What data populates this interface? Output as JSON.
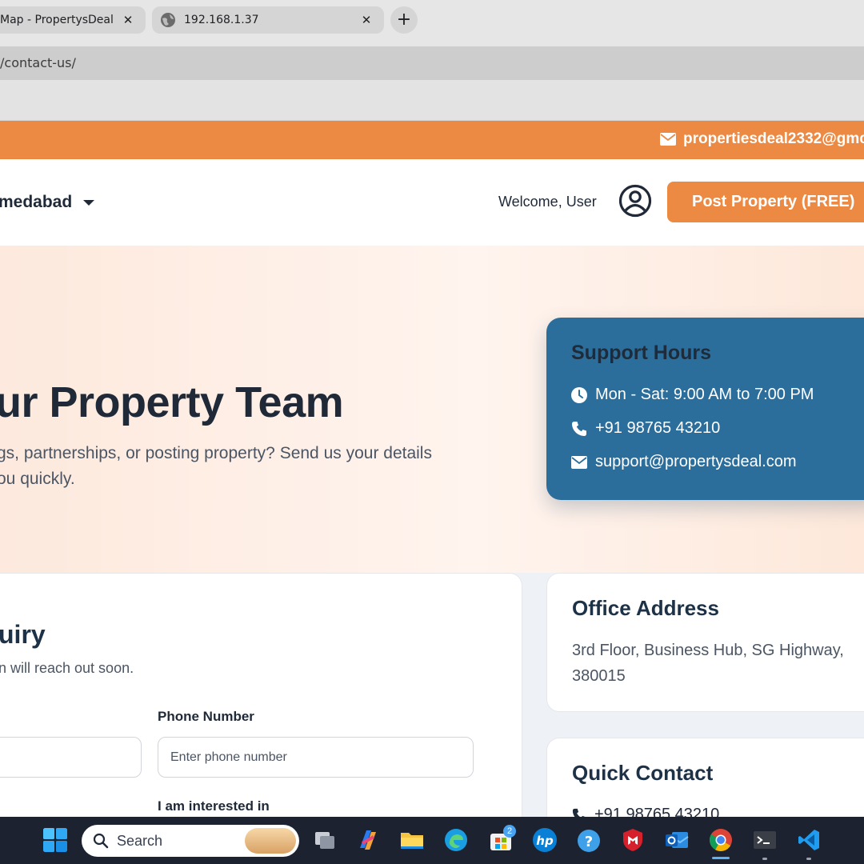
{
  "browser": {
    "tabs": [
      {
        "title": "Map - PropertysDeal"
      },
      {
        "title": "192.168.1.37"
      }
    ],
    "close_glyph": "✕",
    "new_tab_glyph": "+",
    "url": "/contact-us/"
  },
  "topbar": {
    "email": "propertiesdeal2332@gmc"
  },
  "navbar": {
    "city": "medabad",
    "welcome": "Welcome, User",
    "post_button": "Post Property (FREE)"
  },
  "hero": {
    "title": "ur Property Team",
    "subtitle_line1": "gs, partnerships, or posting property? Send us your details",
    "subtitle_line2": "ou quickly."
  },
  "support": {
    "title": "Support Hours",
    "hours": "Mon - Sat: 9:00 AM to 7:00 PM",
    "phone": "+91 98765 43210",
    "email": "support@propertysdeal.com"
  },
  "form": {
    "title": "uiry",
    "subtitle": "n will reach out soon.",
    "phone_label": "Phone Number",
    "phone_placeholder": "Enter phone number",
    "interest_label": "I am interested in"
  },
  "office": {
    "title": "Office Address",
    "address_line1": "3rd Floor, Business Hub, SG Highway,",
    "address_line2": "380015"
  },
  "quick_contact": {
    "title": "Quick Contact",
    "phone": "+91 98765 43210"
  },
  "taskbar": {
    "search_label": "Search",
    "store_badge": "2",
    "icons": [
      "windows-start-icon",
      "search-icon",
      "task-view-icon",
      "copilot-icon",
      "file-explorer-icon",
      "edge-icon",
      "microsoft-store-icon",
      "hp-icon",
      "help-icon",
      "mcafee-icon",
      "outlook-icon",
      "chrome-icon",
      "terminal-icon",
      "vscode-icon"
    ]
  },
  "colors": {
    "brand_orange": "#ec8a44",
    "support_blue": "#2c6e9b",
    "heading_dark": "#1d3147"
  }
}
